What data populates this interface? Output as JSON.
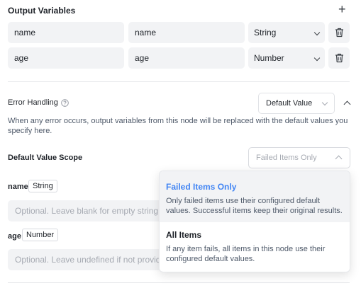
{
  "output_variables": {
    "title": "Output Variables",
    "add_icon": "plus-icon",
    "rows": [
      {
        "name": "name",
        "value": "name",
        "type": "String"
      },
      {
        "name": "age",
        "value": "age",
        "type": "Number"
      }
    ],
    "delete_icon": "trash-icon"
  },
  "error_handling": {
    "title": "Error Handling",
    "help_icon": "question-circle-icon",
    "mode": "Default Value",
    "description": "When any error occurs, output variables from this node will be replaced with the default values you specify here."
  },
  "scope": {
    "label": "Default Value Scope",
    "placeholder": "Failed Items Only"
  },
  "default_fields": [
    {
      "name": "name",
      "type": "String",
      "placeholder": "Optional. Leave blank for empty string"
    },
    {
      "name": "age",
      "type": "Number",
      "placeholder": "Optional. Leave undefined if not provided"
    }
  ],
  "dropdown": {
    "options": [
      {
        "title": "Failed Items Only",
        "description": "Only failed items use their configured default values. Successful items keep their original results.",
        "selected": true
      },
      {
        "title": "All Items",
        "description": "If any item fails, all items in this node use their configured default values.",
        "selected": false
      }
    ]
  },
  "colors": {
    "accent": "#4285f4",
    "selected_bg": "#f2f3f5"
  }
}
